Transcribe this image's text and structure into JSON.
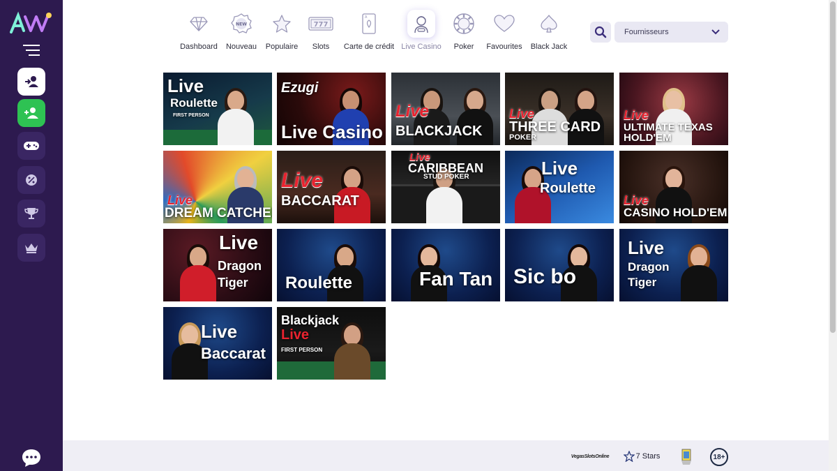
{
  "nav": {
    "items": [
      {
        "label": "Dashboard",
        "icon": "diamond-icon"
      },
      {
        "label": "Nouveau",
        "icon": "new-badge-icon"
      },
      {
        "label": "Populaire",
        "icon": "star-icon"
      },
      {
        "label": "Slots",
        "icon": "slot-machine-icon"
      },
      {
        "label": "Carte de crédit",
        "icon": "card-icon"
      },
      {
        "label": "Live Casino",
        "icon": "dealer-icon"
      },
      {
        "label": "Poker",
        "icon": "poker-chip-icon"
      },
      {
        "label": "Favourites",
        "icon": "heart-icon"
      },
      {
        "label": "Black Jack",
        "icon": "spade-icon"
      }
    ],
    "active_index": 5
  },
  "new_badge_text": "NEW",
  "slots_badge_text": "777",
  "provider_select": {
    "value": "Fournisseurs"
  },
  "colors": {
    "sidebar": "#2d1a4f",
    "accent": "#6c63c9",
    "green": "#2ec253",
    "footer": "#efeef5"
  },
  "games": [
    {
      "lines": [
        "Live",
        "Roulette",
        "FIRST PERSON"
      ]
    },
    {
      "lines": [
        "Ezugi",
        "Live Casino",
        ""
      ]
    },
    {
      "lines": [
        "Live",
        "BLACKJACK",
        ""
      ]
    },
    {
      "lines": [
        "Live",
        "THREE CARD",
        "POKER"
      ]
    },
    {
      "lines": [
        "Live",
        "ULTIMATE TEXAS",
        "HOLD'EM"
      ]
    },
    {
      "lines": [
        "Live",
        "DREAM CATCHER",
        ""
      ]
    },
    {
      "lines": [
        "Live",
        "BACCARAT",
        ""
      ]
    },
    {
      "lines": [
        "Live",
        "CARIBBEAN",
        "STUD POKER"
      ]
    },
    {
      "lines": [
        "Live",
        "Roulette",
        ""
      ]
    },
    {
      "lines": [
        "Live",
        "CASINO HOLD'EM",
        ""
      ]
    },
    {
      "lines": [
        "Live",
        "Dragon",
        "Tiger"
      ]
    },
    {
      "lines": [
        "",
        "Roulette",
        ""
      ]
    },
    {
      "lines": [
        "",
        "Fan Tan",
        ""
      ]
    },
    {
      "lines": [
        "",
        "Sic bo",
        ""
      ]
    },
    {
      "lines": [
        "Live",
        "Dragon",
        "Tiger"
      ]
    },
    {
      "lines": [
        "Live",
        "Baccarat",
        ""
      ]
    },
    {
      "lines": [
        "Blackjack",
        "Live",
        "FIRST PERSON"
      ]
    }
  ],
  "footer": {
    "partners": [
      "VegasSlotsOnline",
      "7 Stars"
    ],
    "age_badge": "18+"
  }
}
